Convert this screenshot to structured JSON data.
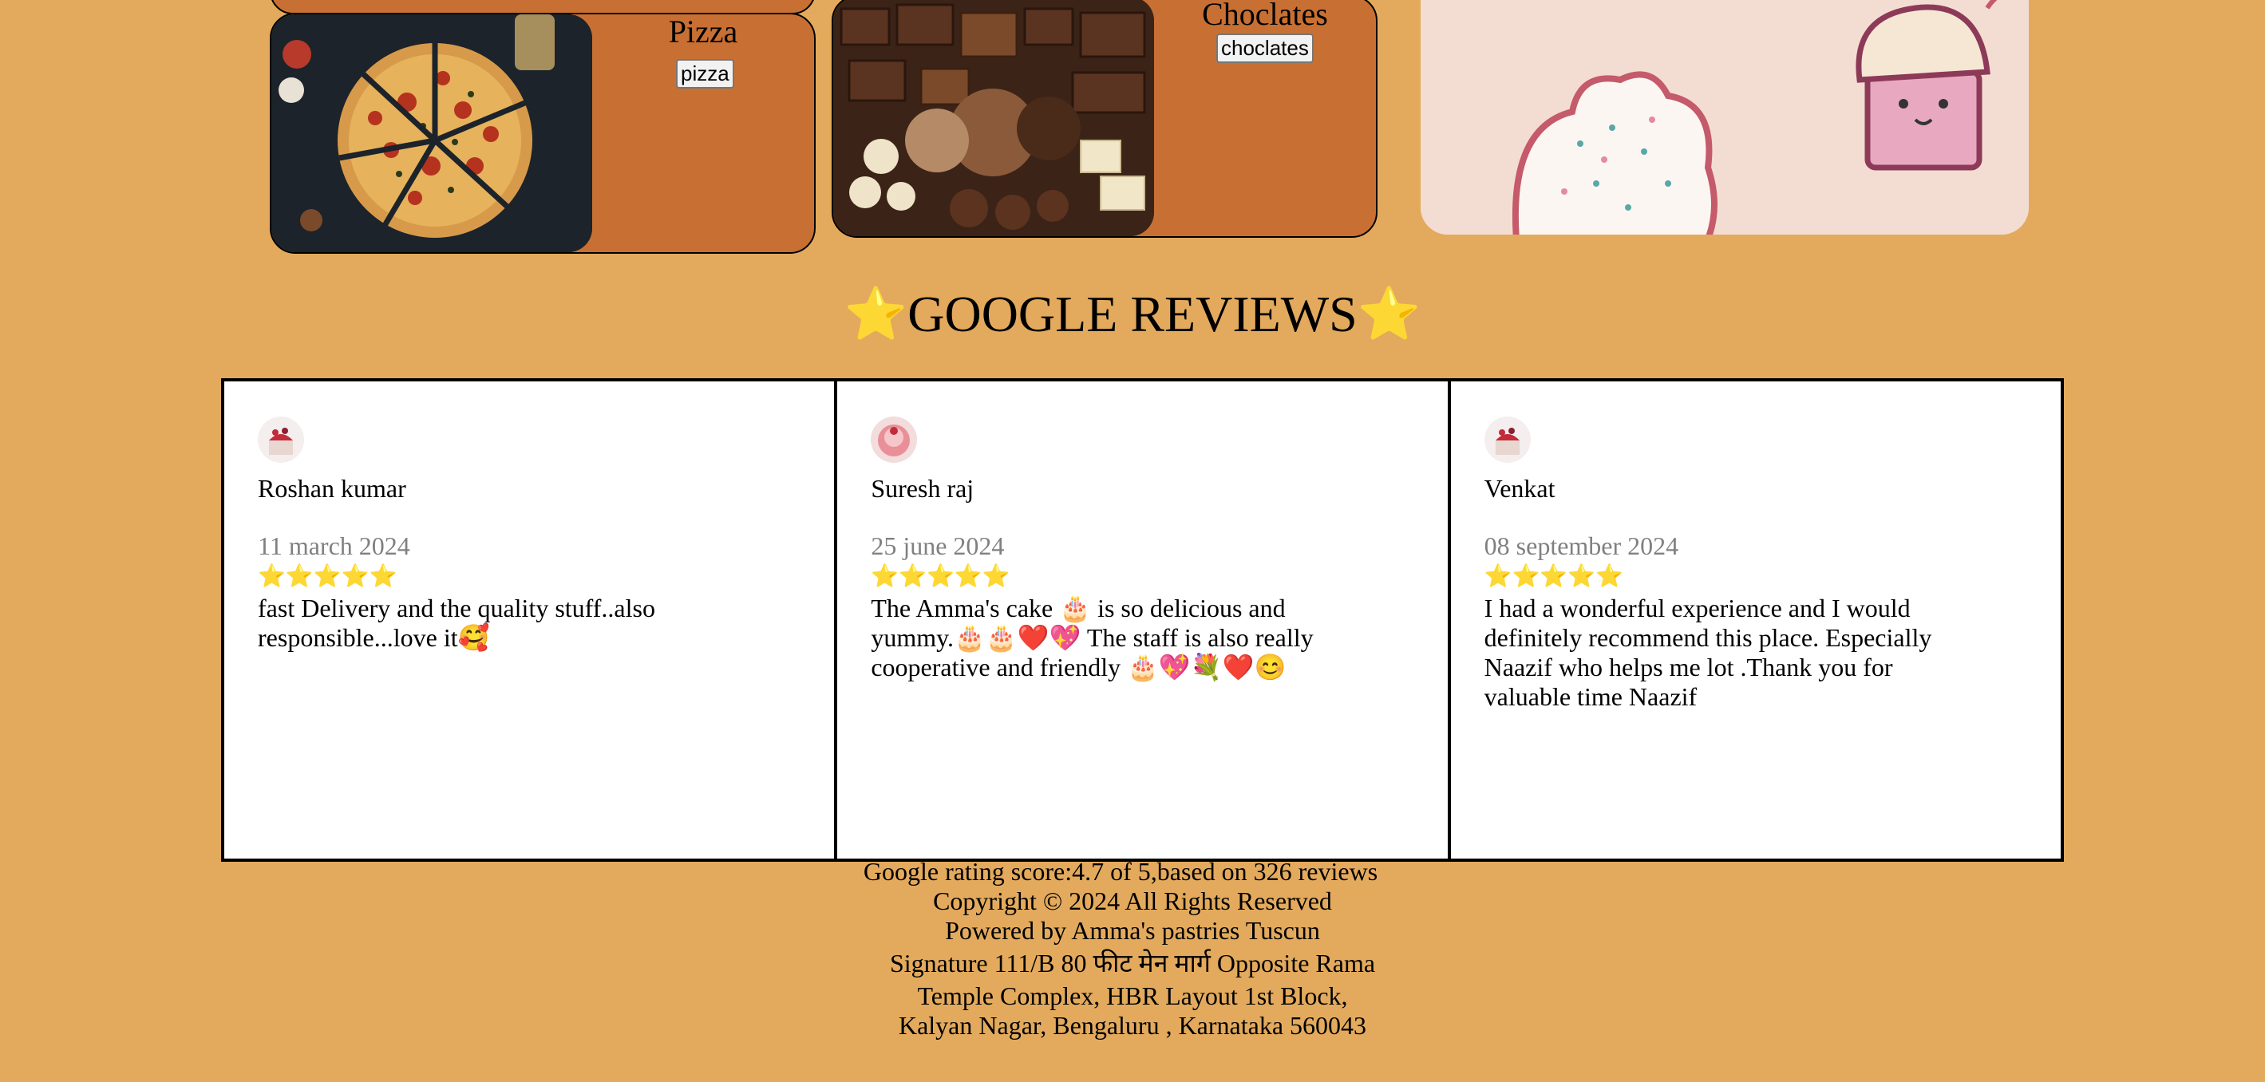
{
  "menu": {
    "pizza": {
      "title": "Pizza",
      "button_label": "pizza"
    },
    "chocolates": {
      "title": "Choclates",
      "button_label": "choclates"
    }
  },
  "reviews": {
    "heading": "⭐GOOGLE REVIEWS⭐",
    "items": [
      {
        "name": "Roshan kumar",
        "date": "11 march 2024",
        "stars": "⭐⭐⭐⭐⭐",
        "text": "fast Delivery and the quality stuff..also responsible...love it🥰"
      },
      {
        "name": "Suresh raj",
        "date": "25 june 2024",
        "stars": "⭐⭐⭐⭐⭐",
        "text": "The Amma's cake 🎂 is so delicious and yummy.🎂🎂❤️💖 The staff is also really cooperative and friendly 🎂💖💐❤️😊"
      },
      {
        "name": "Venkat",
        "date": "08 september 2024",
        "stars": "⭐⭐⭐⭐⭐",
        "text": "I had a wonderful experience and I would definitely recommend this place. Especially Naazif who helps me lot .Thank you for valuable time Naazif"
      }
    ]
  },
  "footer": {
    "rating": "Google rating score:4.7 of 5,based on 326 reviews",
    "copyright": "Copyright © 2024 All Rights Reserved",
    "powered": "Powered by Amma's pastries Tuscun",
    "address_1": "Signature 111/B 80 फीट मेन मार्ग Opposite Rama",
    "address_2": "Temple Complex, HBR Layout 1st Block,",
    "address_3": "Kalyan Nagar, Bengaluru , Karnataka 560043"
  },
  "colors": {
    "page_bg": "#e3aa5d",
    "card_bg": "#c87033",
    "cupcake_bg": "#f3ddd2"
  }
}
